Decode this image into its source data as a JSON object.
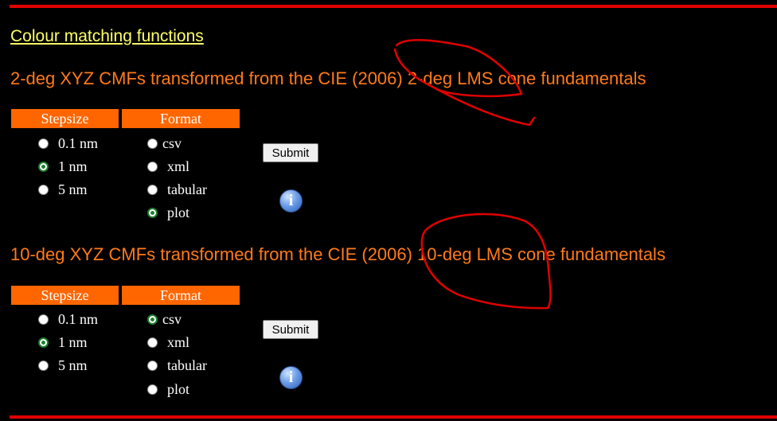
{
  "page": {
    "title_link": "Colour matching functions"
  },
  "sections": [
    {
      "heading": "2-deg XYZ CMFs transformed from the CIE (2006) 2-deg LMS cone fundamentals",
      "stepsize_header": "Stepsize",
      "format_header": "Format",
      "stepsize_options": [
        {
          "label": "0.1 nm",
          "checked": false
        },
        {
          "label": "1 nm",
          "checked": true
        },
        {
          "label": "5 nm",
          "checked": false
        }
      ],
      "format_options": [
        {
          "label": "csv",
          "checked": false
        },
        {
          "label": "xml",
          "checked": false
        },
        {
          "label": "tabular",
          "checked": false
        },
        {
          "label": "plot",
          "checked": true
        }
      ],
      "submit_label": "Submit",
      "info_icon": "i"
    },
    {
      "heading": "10-deg XYZ CMFs transformed from the CIE (2006) 10-deg LMS cone fundamentals",
      "stepsize_header": "Stepsize",
      "format_header": "Format",
      "stepsize_options": [
        {
          "label": "0.1 nm",
          "checked": false
        },
        {
          "label": "1 nm",
          "checked": true
        },
        {
          "label": "5 nm",
          "checked": false
        }
      ],
      "format_options": [
        {
          "label": "csv",
          "checked": true
        },
        {
          "label": "xml",
          "checked": false
        },
        {
          "label": "tabular",
          "checked": false
        },
        {
          "label": "plot",
          "checked": false
        }
      ],
      "submit_label": "Submit",
      "info_icon": "i"
    }
  ],
  "colors": {
    "background": "#000000",
    "rule": "#e00000",
    "link": "#ffff66",
    "heading": "#ff7a1a",
    "table_header": "#ff6600",
    "annotation": "#e00000"
  }
}
